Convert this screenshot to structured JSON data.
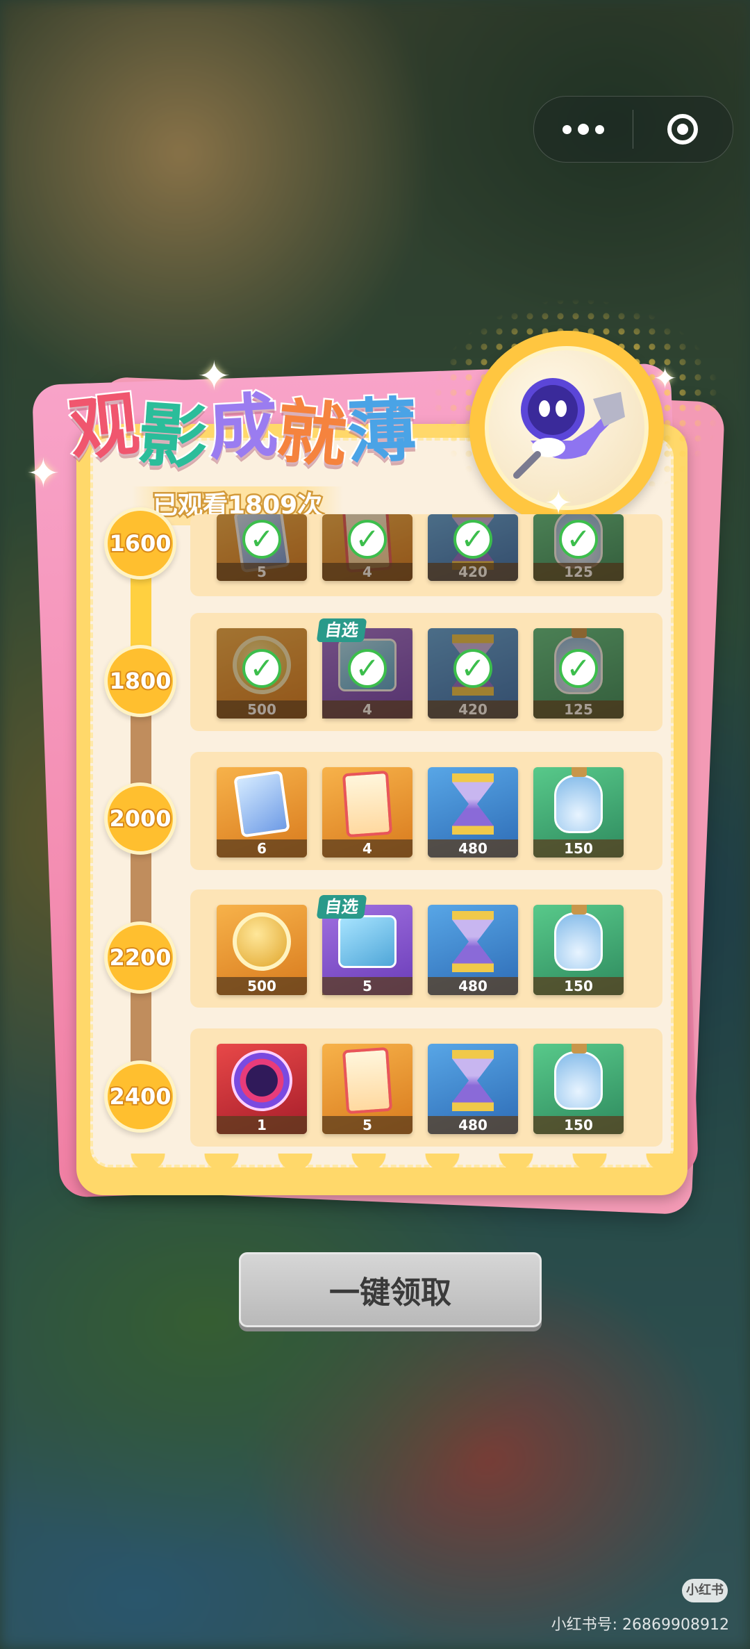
{
  "title_chars": [
    "观",
    "影",
    "成",
    "就",
    "薄"
  ],
  "subtitle": "已观看1809次",
  "rows": [
    {
      "milestone": "1600",
      "items": [
        {
          "icon": "card-icon",
          "qty": "5",
          "claimed": true
        },
        {
          "icon": "ticket-icon",
          "qty": "4",
          "claimed": true
        },
        {
          "icon": "hourglass-icon",
          "qty": "420",
          "claimed": true
        },
        {
          "icon": "bottle-icon",
          "qty": "125",
          "claimed": true
        }
      ]
    },
    {
      "milestone": "1800",
      "items": [
        {
          "icon": "coin-icon",
          "qty": "500",
          "claimed": true
        },
        {
          "icon": "gift-bag-icon",
          "qty": "4",
          "claimed": true,
          "tag": "自选"
        },
        {
          "icon": "hourglass-icon",
          "qty": "420",
          "claimed": true
        },
        {
          "icon": "bottle-icon",
          "qty": "125",
          "claimed": true
        }
      ]
    },
    {
      "milestone": "2000",
      "items": [
        {
          "icon": "card-icon",
          "qty": "6",
          "claimed": false
        },
        {
          "icon": "ticket-icon",
          "qty": "4",
          "claimed": false
        },
        {
          "icon": "hourglass-icon",
          "qty": "480",
          "claimed": false
        },
        {
          "icon": "bottle-icon",
          "qty": "150",
          "claimed": false
        }
      ]
    },
    {
      "milestone": "2200",
      "items": [
        {
          "icon": "coin-icon",
          "qty": "500",
          "claimed": false
        },
        {
          "icon": "gift-bag-icon",
          "qty": "5",
          "claimed": false,
          "tag": "自选"
        },
        {
          "icon": "hourglass-icon",
          "qty": "480",
          "claimed": false
        },
        {
          "icon": "bottle-icon",
          "qty": "150",
          "claimed": false
        }
      ]
    },
    {
      "milestone": "2400",
      "items": [
        {
          "icon": "clock-icon",
          "qty": "1",
          "claimed": false
        },
        {
          "icon": "ticket-icon",
          "qty": "5",
          "claimed": false
        },
        {
          "icon": "hourglass-icon",
          "qty": "480",
          "claimed": false
        },
        {
          "icon": "bottle-icon",
          "qty": "150",
          "claimed": false
        }
      ]
    }
  ],
  "claim_button": "一键领取",
  "watermark": {
    "logo": "小红书",
    "text": "小红书号: 26869908912"
  },
  "colors": {
    "panel": "#ffd86a",
    "panel_inner": "#fbf0df",
    "row": "#fde4b6",
    "node": "#ffbf2f",
    "check": "#3cbe4c"
  }
}
